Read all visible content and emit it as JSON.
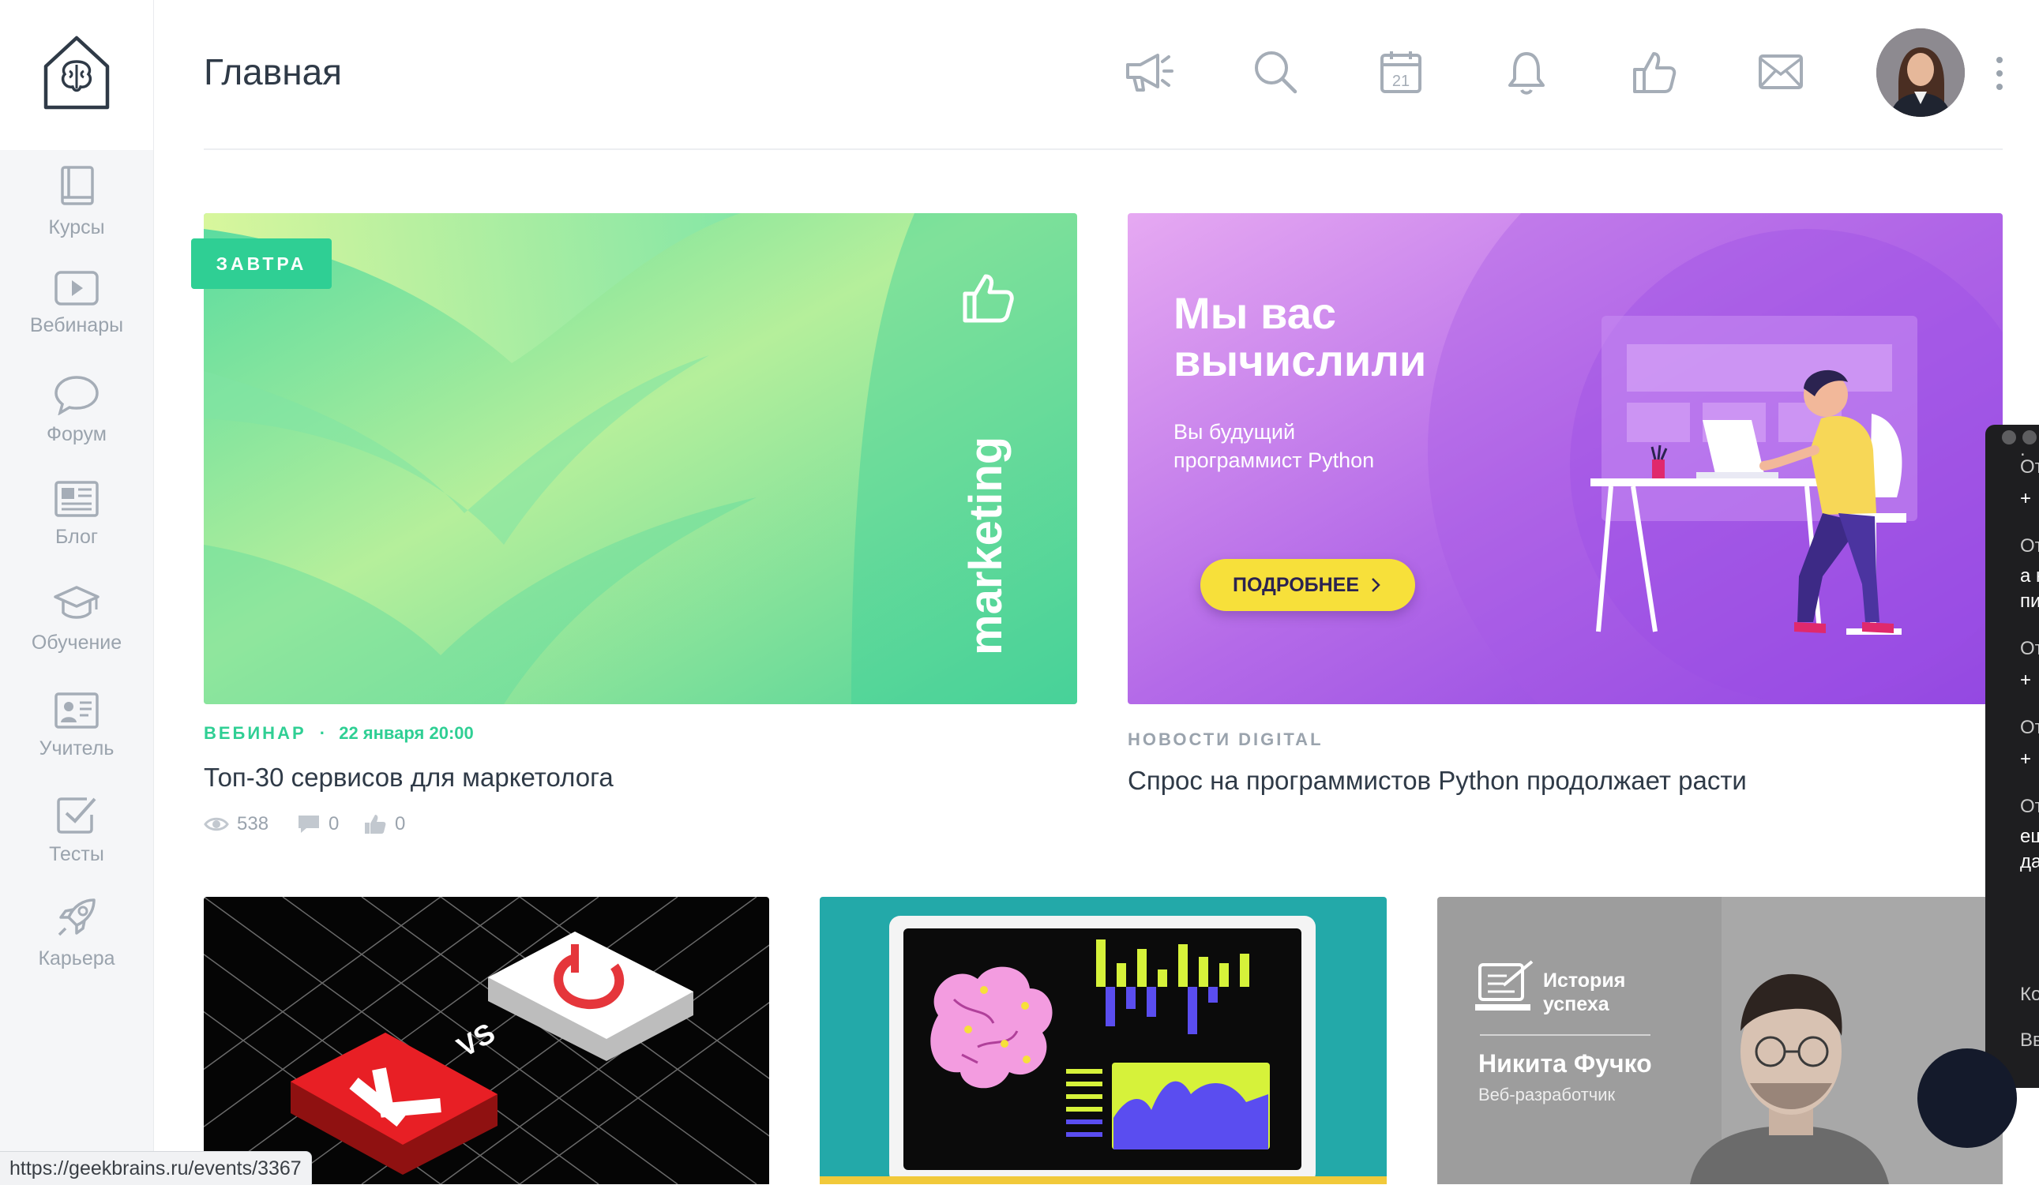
{
  "header": {
    "title": "Главная"
  },
  "header_icons": [
    "megaphone-icon",
    "search-icon",
    "calendar-icon",
    "bell-icon",
    "thumbs-up-icon",
    "mail-icon"
  ],
  "calendar_day": "21",
  "sidebar": {
    "items": [
      {
        "label": "Курсы",
        "icon": "book-icon"
      },
      {
        "label": "Вебинары",
        "icon": "play-icon"
      },
      {
        "label": "Форум",
        "icon": "chat-bubble-icon"
      },
      {
        "label": "Блог",
        "icon": "newspaper-icon"
      },
      {
        "label": "Обучение",
        "icon": "graduation-cap-icon"
      },
      {
        "label": "Учитель",
        "icon": "teacher-board-icon"
      },
      {
        "label": "Тесты",
        "icon": "checkbox-icon"
      },
      {
        "label": "Карьера",
        "icon": "rocket-icon"
      }
    ]
  },
  "card1": {
    "badge": "ЗАВТРА",
    "image_text": "marketing",
    "category": "ВЕБИНАР",
    "separator": "·",
    "date": "22 января 20:00",
    "title": "Топ-30 сервисов для маркетолога",
    "views": "538",
    "comments": "0",
    "likes": "0"
  },
  "card2": {
    "promo_title_line1": "Мы вас",
    "promo_title_line2": "вычислили",
    "promo_subtitle_line1": "Вы будущий",
    "promo_subtitle_line2": "программист Python",
    "button_label": "ПОДРОБНЕЕ",
    "category": "НОВОСТИ DIGITAL",
    "title": "Спрос на программистов Python продолжает расти"
  },
  "card3": {
    "vs_text": "VS"
  },
  "card5": {
    "story_label_line1": "История",
    "story_label_line2": "успеха",
    "person_name": "Никита Фучко",
    "person_role": "Веб-разработчик"
  },
  "status_url": "https://geekbrains.ru/events/3367",
  "overlay_fragments": [
    ".",
    "От",
    "+",
    "От",
    "а н",
    "пи",
    "От",
    "+",
    "От",
    "+",
    "От",
    "ещ",
    "да",
    "Ко",
    "Вв"
  ],
  "colors": {
    "accent_green": "#2fcf94",
    "promo_yellow": "#f7e03a",
    "promo_purple": "#9b4fe0"
  }
}
